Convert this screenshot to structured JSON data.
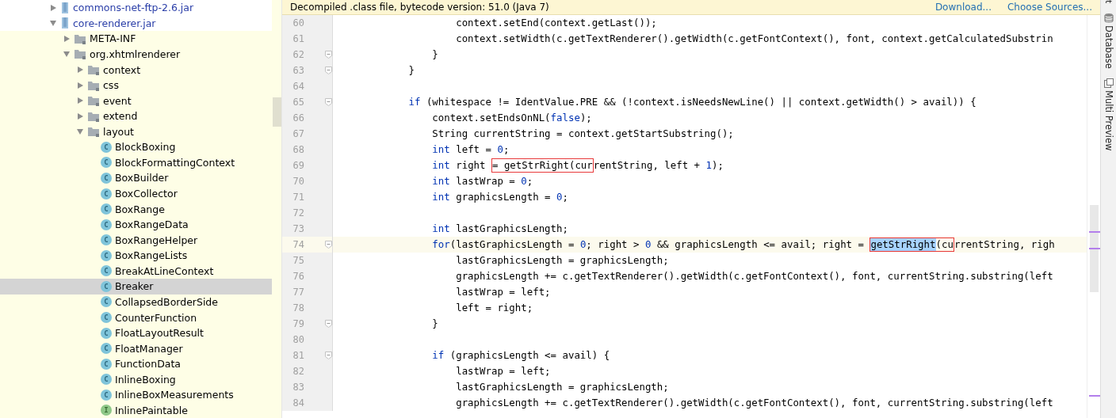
{
  "project_tree": {
    "items": [
      {
        "kind": "jar",
        "label": "commons-net-ftp-2.6.jar",
        "expanded": false,
        "selected": false,
        "library": false
      },
      {
        "kind": "jar",
        "label": "core-renderer.jar",
        "expanded": true,
        "selected": false,
        "library": false,
        "children": [
          {
            "kind": "folder",
            "label": "META-INF",
            "expanded": false,
            "selected": false,
            "library": true
          },
          {
            "kind": "folder",
            "label": "org.xhtmlrenderer",
            "expanded": true,
            "selected": false,
            "library": true,
            "children": [
              {
                "kind": "folder",
                "label": "context",
                "expanded": false,
                "selected": false,
                "library": true
              },
              {
                "kind": "folder",
                "label": "css",
                "expanded": false,
                "selected": false,
                "library": true
              },
              {
                "kind": "folder",
                "label": "event",
                "expanded": false,
                "selected": false,
                "library": true
              },
              {
                "kind": "folder",
                "label": "extend",
                "expanded": false,
                "selected": false,
                "library": true
              },
              {
                "kind": "folder",
                "label": "layout",
                "expanded": true,
                "selected": false,
                "library": true,
                "children": [
                  {
                    "kind": "class",
                    "badge": "C",
                    "label": "BlockBoxing",
                    "selected": false,
                    "library": true
                  },
                  {
                    "kind": "class",
                    "badge": "C",
                    "label": "BlockFormattingContext",
                    "selected": false,
                    "library": true
                  },
                  {
                    "kind": "class",
                    "badge": "C",
                    "label": "BoxBuilder",
                    "selected": false,
                    "library": true
                  },
                  {
                    "kind": "class",
                    "badge": "C",
                    "label": "BoxCollector",
                    "selected": false,
                    "library": true
                  },
                  {
                    "kind": "class",
                    "badge": "C",
                    "label": "BoxRange",
                    "selected": false,
                    "library": true
                  },
                  {
                    "kind": "class",
                    "badge": "C",
                    "label": "BoxRangeData",
                    "selected": false,
                    "library": true
                  },
                  {
                    "kind": "class",
                    "badge": "C",
                    "label": "BoxRangeHelper",
                    "selected": false,
                    "library": true
                  },
                  {
                    "kind": "class",
                    "badge": "C",
                    "label": "BoxRangeLists",
                    "selected": false,
                    "library": true
                  },
                  {
                    "kind": "class",
                    "badge": "C",
                    "label": "BreakAtLineContext",
                    "selected": false,
                    "library": true
                  },
                  {
                    "kind": "class",
                    "badge": "C",
                    "label": "Breaker",
                    "selected": true,
                    "library": true
                  },
                  {
                    "kind": "class",
                    "badge": "C",
                    "label": "CollapsedBorderSide",
                    "selected": false,
                    "library": true
                  },
                  {
                    "kind": "class",
                    "badge": "C",
                    "label": "CounterFunction",
                    "selected": false,
                    "library": true
                  },
                  {
                    "kind": "class",
                    "badge": "C",
                    "label": "FloatLayoutResult",
                    "selected": false,
                    "library": true
                  },
                  {
                    "kind": "class",
                    "badge": "C",
                    "label": "FloatManager",
                    "selected": false,
                    "library": true
                  },
                  {
                    "kind": "class",
                    "badge": "C",
                    "label": "FunctionData",
                    "selected": false,
                    "library": true
                  },
                  {
                    "kind": "class",
                    "badge": "C",
                    "label": "InlineBoxing",
                    "selected": false,
                    "library": true
                  },
                  {
                    "kind": "class",
                    "badge": "C",
                    "label": "InlineBoxMeasurements",
                    "selected": false,
                    "library": true
                  },
                  {
                    "kind": "interface",
                    "badge": "I",
                    "label": "InlinePaintable",
                    "selected": false,
                    "library": true
                  }
                ]
              }
            ]
          }
        ]
      }
    ]
  },
  "editor": {
    "notice": {
      "text": "Decompiled .class file, bytecode version: 51.0 (Java 7)",
      "links": [
        "Download...",
        "Choose Sources..."
      ]
    },
    "lines": [
      {
        "number": "60",
        "current": false,
        "fold": false,
        "tokens": [
          {
            "kind": "plain",
            "text": "                    context.setEnd(context.getLast());"
          }
        ]
      },
      {
        "number": "61",
        "current": false,
        "fold": false,
        "tokens": [
          {
            "kind": "plain",
            "text": "                    context.setWidth(c.getTextRenderer().getWidth(c.getFontContext(), font, context.getCalculatedSubstrin"
          }
        ]
      },
      {
        "number": "62",
        "current": false,
        "fold": true,
        "tokens": [
          {
            "kind": "plain",
            "text": "                }"
          }
        ]
      },
      {
        "number": "63",
        "current": false,
        "fold": true,
        "tokens": [
          {
            "kind": "plain",
            "text": "            }"
          }
        ]
      },
      {
        "number": "64",
        "current": false,
        "fold": false
      },
      {
        "number": "65",
        "current": false,
        "fold": true,
        "tokens": [
          {
            "kind": "keyword",
            "text": "            if"
          },
          {
            "kind": "plain",
            "text": " (whitespace != IdentValue.PRE && (!context.isNeedsNewLine() || context.getWidth() > avail)) {"
          }
        ]
      },
      {
        "number": "66",
        "current": false,
        "fold": false,
        "tokens": [
          {
            "kind": "plain",
            "text": "                context.setEndsOnNL("
          },
          {
            "kind": "keyword",
            "text": "false"
          },
          {
            "kind": "plain",
            "text": ");"
          }
        ]
      },
      {
        "number": "67",
        "current": false,
        "fold": false,
        "tokens": [
          {
            "kind": "plain",
            "text": "                String currentString = context.getStartSubstring();"
          }
        ]
      },
      {
        "number": "68",
        "current": false,
        "fold": false,
        "tokens": [
          {
            "kind": "keyword",
            "text": "                int"
          },
          {
            "kind": "plain",
            "text": " left = "
          },
          {
            "kind": "number",
            "text": "0"
          },
          {
            "kind": "plain",
            "text": ";"
          }
        ]
      },
      {
        "number": "69",
        "current": false,
        "fold": false,
        "tokens": [
          {
            "kind": "keyword",
            "text": "                int"
          },
          {
            "kind": "plain",
            "text": " right "
          },
          {
            "kind": "boxed",
            "text": "= getStrRight(cur"
          },
          {
            "kind": "plain",
            "text": "rentString, left + "
          },
          {
            "kind": "number",
            "text": "1"
          },
          {
            "kind": "plain",
            "text": ");"
          }
        ]
      },
      {
        "number": "70",
        "current": false,
        "fold": false,
        "tokens": [
          {
            "kind": "keyword",
            "text": "                int"
          },
          {
            "kind": "plain",
            "text": " lastWrap = "
          },
          {
            "kind": "number",
            "text": "0"
          },
          {
            "kind": "plain",
            "text": ";"
          }
        ]
      },
      {
        "number": "71",
        "current": false,
        "fold": false,
        "tokens": [
          {
            "kind": "keyword",
            "text": "                int"
          },
          {
            "kind": "plain",
            "text": " graphicsLength = "
          },
          {
            "kind": "number",
            "text": "0"
          },
          {
            "kind": "plain",
            "text": ";"
          }
        ]
      },
      {
        "number": "72",
        "current": false,
        "fold": false
      },
      {
        "number": "73",
        "current": false,
        "fold": false,
        "tokens": [
          {
            "kind": "keyword",
            "text": "                int"
          },
          {
            "kind": "plain",
            "text": " lastGraphicsLength;"
          }
        ]
      },
      {
        "number": "74",
        "current": true,
        "fold": true,
        "tokens": [
          {
            "kind": "keyword",
            "text": "                for"
          },
          {
            "kind": "plain",
            "text": "(lastGraphicsLength = "
          },
          {
            "kind": "number",
            "text": "0"
          },
          {
            "kind": "plain",
            "text": "; right > "
          },
          {
            "kind": "number",
            "text": "0"
          },
          {
            "kind": "plain",
            "text": " && graphicsLength <= avail; right = "
          },
          {
            "kind": "selected-boxed",
            "text": "getStrRight"
          },
          {
            "kind": "boxed-tail",
            "text": "(cu"
          },
          {
            "kind": "plain",
            "text": "rrentString, righ"
          }
        ]
      },
      {
        "number": "75",
        "current": false,
        "fold": false,
        "tokens": [
          {
            "kind": "plain",
            "text": "                    lastGraphicsLength = graphicsLength;"
          }
        ]
      },
      {
        "number": "76",
        "current": false,
        "fold": false,
        "tokens": [
          {
            "kind": "plain",
            "text": "                    graphicsLength += c.getTextRenderer().getWidth(c.getFontContext(), font, currentString.substring(left"
          }
        ]
      },
      {
        "number": "77",
        "current": false,
        "fold": false,
        "tokens": [
          {
            "kind": "plain",
            "text": "                    lastWrap = left;"
          }
        ]
      },
      {
        "number": "78",
        "current": false,
        "fold": false,
        "tokens": [
          {
            "kind": "plain",
            "text": "                    left = right;"
          }
        ]
      },
      {
        "number": "79",
        "current": false,
        "fold": true,
        "tokens": [
          {
            "kind": "plain",
            "text": "                }"
          }
        ]
      },
      {
        "number": "80",
        "current": false,
        "fold": false
      },
      {
        "number": "81",
        "current": false,
        "fold": true,
        "tokens": [
          {
            "kind": "keyword",
            "text": "                if"
          },
          {
            "kind": "plain",
            "text": " (graphicsLength <= avail) {"
          }
        ]
      },
      {
        "number": "82",
        "current": false,
        "fold": false,
        "tokens": [
          {
            "kind": "plain",
            "text": "                    lastWrap = left;"
          }
        ]
      },
      {
        "number": "83",
        "current": false,
        "fold": false,
        "tokens": [
          {
            "kind": "plain",
            "text": "                    lastGraphicsLength = graphicsLength;"
          }
        ]
      },
      {
        "number": "84",
        "current": false,
        "fold": false,
        "tokens": [
          {
            "kind": "plain",
            "text": "                    graphicsLength += c.getTextRenderer().getWidth(c.getFontContext(), font, currentString.substring(left"
          }
        ]
      }
    ]
  },
  "tool_strip": {
    "tabs": [
      {
        "kind": "cut",
        "label": "t"
      },
      {
        "kind": "database",
        "label": "Database"
      },
      {
        "kind": "preview",
        "label": "Multi Preview"
      }
    ]
  }
}
